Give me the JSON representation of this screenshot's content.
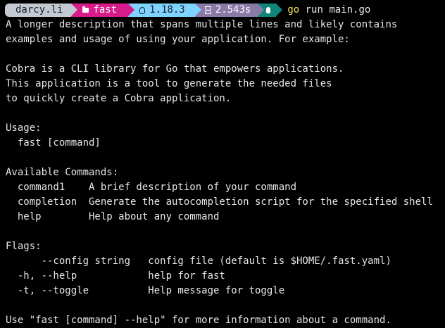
{
  "prompt": {
    "user": "darcy.li",
    "directory": "fast",
    "go_version": "1.18.3",
    "duration": "2.543s",
    "status_icon": "check-icon",
    "command_name": "go",
    "command_args": " run main.go"
  },
  "colors": {
    "background": "#000000",
    "text": "#e6e6e6",
    "segment_user": "#c4c8d0",
    "segment_directory": "#d81b8a",
    "segment_go": "#7fd3ff",
    "segment_time": "#8a7aa8",
    "segment_status": "#10857a",
    "command": "#f6e05e"
  },
  "output_lines": [
    "A longer description that spans multiple lines and likely contains",
    "examples and usage of using your application. For example:",
    "",
    "Cobra is a CLI library for Go that empowers applications.",
    "This application is a tool to generate the needed files",
    "to quickly create a Cobra application.",
    "",
    "Usage:",
    "  fast [command]",
    "",
    "Available Commands:",
    "  command1    A brief description of your command",
    "  completion  Generate the autocompletion script for the specified shell",
    "  help        Help about any command",
    "",
    "Flags:",
    "      --config string   config file (default is $HOME/.fast.yaml)",
    "  -h, --help            help for fast",
    "  -t, --toggle          Help message for toggle",
    "",
    "Use \"fast [command] --help\" for more information about a command."
  ]
}
